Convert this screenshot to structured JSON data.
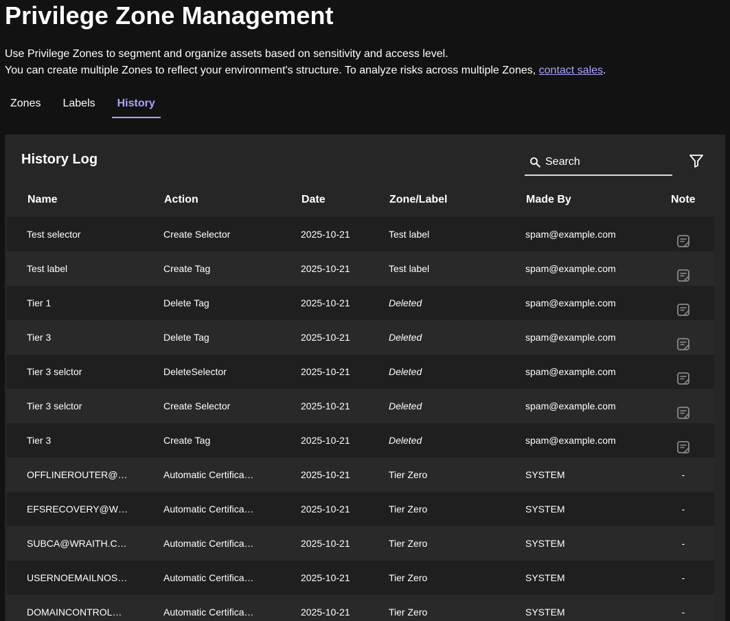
{
  "page": {
    "title": "Privilege Zone Management",
    "description_line1": "Use Privilege Zones to segment and organize assets based on sensitivity and access level.",
    "description_line2": "You can create multiple Zones to reflect your environment's structure. To analyze risks across multiple Zones,",
    "contact_link": "contact sales",
    "description_end": "."
  },
  "tabs": [
    {
      "label": "Zones",
      "active": false
    },
    {
      "label": "Labels",
      "active": false
    },
    {
      "label": "History",
      "active": true
    }
  ],
  "history": {
    "title": "History Log",
    "search_placeholder": "Search",
    "filter_icon": "filter-icon",
    "columns": {
      "name": "Name",
      "action": "Action",
      "date": "Date",
      "zone": "Zone/Label",
      "made_by": "Made By",
      "note": "Note"
    },
    "rows": [
      {
        "name": "Test selector",
        "action": "Create Selector",
        "date": "2025-10-21",
        "zone": "Test label",
        "made_by": "spam@example.com",
        "note": "note-icon"
      },
      {
        "name": "Test label",
        "action": "Create Tag",
        "date": "2025-10-21",
        "zone": "Test label",
        "made_by": "spam@example.com",
        "note": "note-icon"
      },
      {
        "name": "Tier 1",
        "action": "Delete Tag",
        "date": "2025-10-21",
        "zone": "Deleted",
        "made_by": "spam@example.com",
        "note": "note-icon"
      },
      {
        "name": "Tier 3",
        "action": "Delete Tag",
        "date": "2025-10-21",
        "zone": "Deleted",
        "made_by": "spam@example.com",
        "note": "note-icon"
      },
      {
        "name": "Tier 3 selctor",
        "action": "DeleteSelector",
        "date": "2025-10-21",
        "zone": "Deleted",
        "made_by": "spam@example.com",
        "note": "note-icon"
      },
      {
        "name": "Tier 3 selctor",
        "action": "Create Selector",
        "date": "2025-10-21",
        "zone": "Deleted",
        "made_by": "spam@example.com",
        "note": "note-icon"
      },
      {
        "name": "Tier 3",
        "action": "Create Tag",
        "date": "2025-10-21",
        "zone": "Deleted",
        "made_by": "spam@example.com",
        "note": "note-icon"
      },
      {
        "name": "OFFLINEROUTER@…",
        "action": "Automatic Certifica…",
        "date": "2025-10-21",
        "zone": "Tier Zero",
        "made_by": "SYSTEM",
        "note": "-"
      },
      {
        "name": "EFSRECOVERY@W…",
        "action": "Automatic Certifica…",
        "date": "2025-10-21",
        "zone": "Tier Zero",
        "made_by": "SYSTEM",
        "note": "-"
      },
      {
        "name": "SUBCA@WRAITH.C…",
        "action": "Automatic Certifica…",
        "date": "2025-10-21",
        "zone": "Tier Zero",
        "made_by": "SYSTEM",
        "note": "-"
      },
      {
        "name": "USERNOEMAILNOS…",
        "action": "Automatic Certifica…",
        "date": "2025-10-21",
        "zone": "Tier Zero",
        "made_by": "SYSTEM",
        "note": "-"
      },
      {
        "name": "DOMAINCONTROL…",
        "action": "Automatic Certifica…",
        "date": "2025-10-21",
        "zone": "Tier Zero",
        "made_by": "SYSTEM",
        "note": "-"
      }
    ]
  },
  "colors": {
    "background": "#121212",
    "panel": "#262626",
    "accent": "#a9a4ff"
  }
}
